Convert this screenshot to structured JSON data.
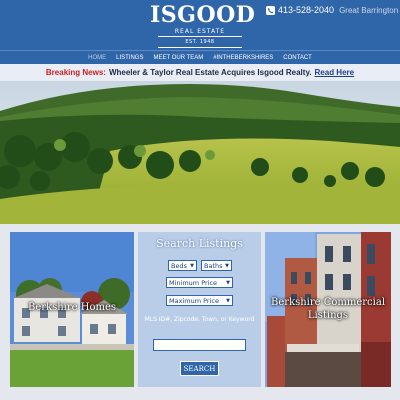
{
  "header": {
    "logo": "ISGOOD",
    "logo_sub": "REAL ESTATE",
    "logo_est": "EST. 1948",
    "phone": "413-528-2040",
    "location": "Great Barrington"
  },
  "nav": {
    "items": [
      "HOME",
      "LISTINGS",
      "MEET OUR TEAM",
      "#INTHEBERKSHIRES",
      "CONTACT"
    ]
  },
  "news": {
    "label": "Breaking News:",
    "text": "Wheeler & Taylor Real Estate Acquires Isgood Realty.",
    "link": "Read Here"
  },
  "panels": {
    "left_title": "Berkshire Homes",
    "right_title": "Berkshire Commercial Listings"
  },
  "search": {
    "title": "Search Listings",
    "beds": "Beds",
    "baths": "Baths",
    "min_price": "Minimum Price",
    "max_price": "Maximum Price",
    "hint": "MLS ID#, Zipcode, Town, or Keyword",
    "input_value": "",
    "button": "SEARCH"
  },
  "colors": {
    "brand_blue": "#2f65a9",
    "breaking_red": "#cc1f1f",
    "search_panel": "#b9cde8"
  }
}
